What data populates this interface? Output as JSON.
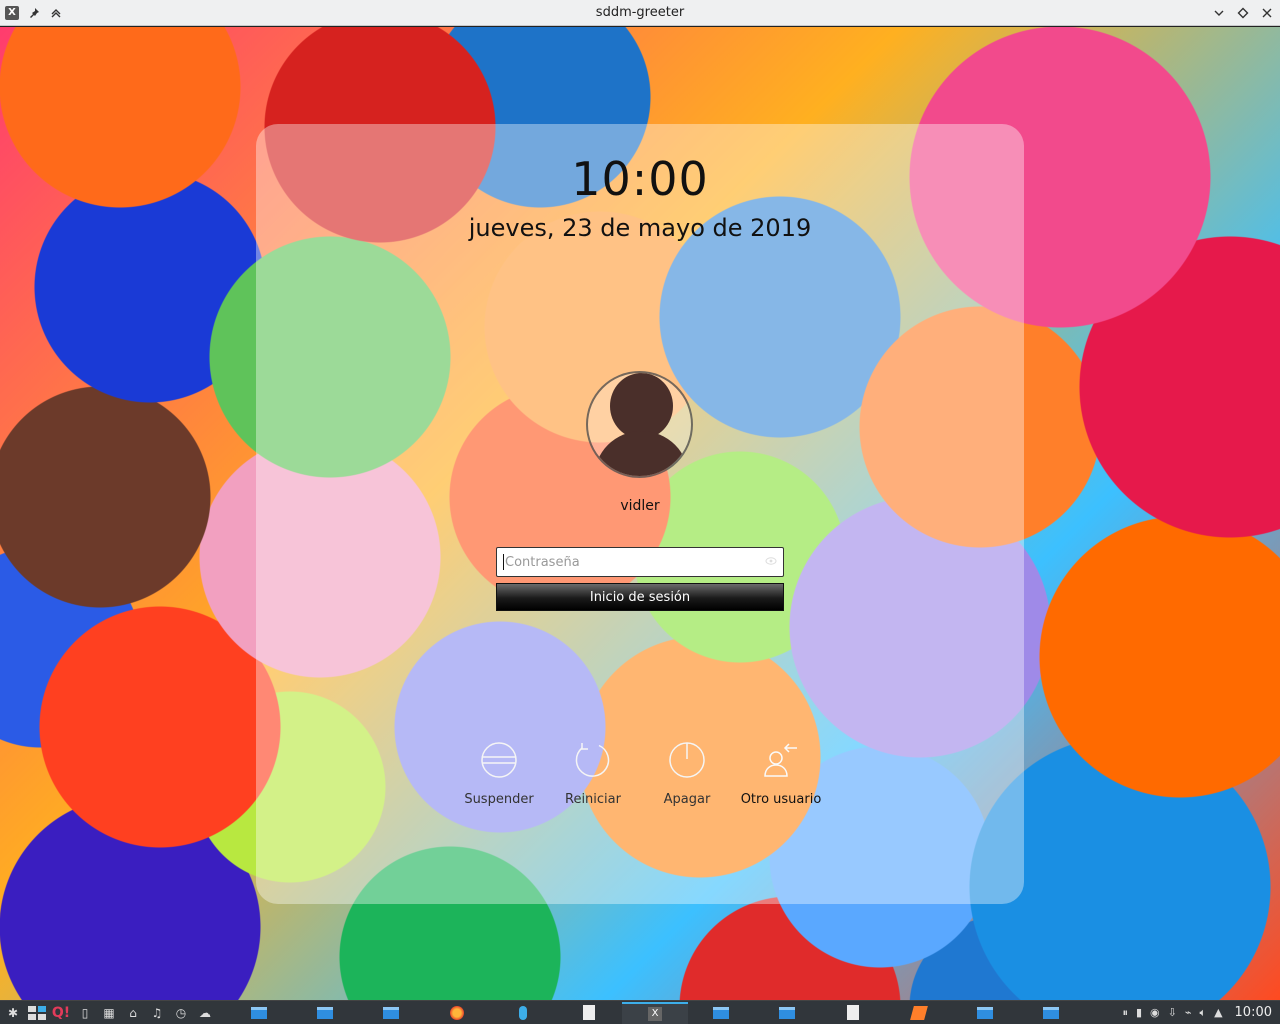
{
  "window": {
    "title": "sddm-greeter",
    "left_icons": [
      "x-app-icon",
      "pin-icon",
      "keep-above-icon"
    ],
    "right_icons": [
      "minimize-icon",
      "maximize-icon",
      "close-icon"
    ]
  },
  "greeter": {
    "time": "10:00",
    "date": "jueves, 23 de mayo de 2019",
    "username": "vidler",
    "password_placeholder": "Contraseña",
    "login_label": "Inicio de sesión",
    "actions": [
      {
        "id": "suspend",
        "label": "Suspender",
        "icon": "suspend-icon"
      },
      {
        "id": "reboot",
        "label": "Reiniciar",
        "icon": "restart-icon"
      },
      {
        "id": "shutdown",
        "label": "Apagar",
        "icon": "power-icon"
      },
      {
        "id": "other",
        "label": "Otro usuario",
        "icon": "switch-user-icon"
      }
    ]
  },
  "taskbar": {
    "launchers": [
      "app-menu-icon",
      "desktop-pager-icon",
      "qmmp-icon",
      "file-icon",
      "grid-icon",
      "home-icon",
      "music-icon",
      "clock-icon",
      "network-icon"
    ],
    "tasks": [
      "window",
      "window",
      "window",
      "firefox",
      "microphone",
      "document",
      "x-app",
      "window",
      "window",
      "document",
      "paint",
      "window",
      "window"
    ],
    "active_task_index": 6,
    "tray": [
      "pause-icon",
      "battery-icon",
      "updates-icon",
      "download-icon",
      "wifi-icon",
      "volume-icon",
      "tray-expand-icon"
    ],
    "clock": "10:00"
  },
  "colors": {
    "accent": "#3daee9",
    "panel_overlay": "rgba(255,255,255,0.38)",
    "taskbar_bg": "#31363b",
    "avatar_fill": "#4a2f2a"
  }
}
